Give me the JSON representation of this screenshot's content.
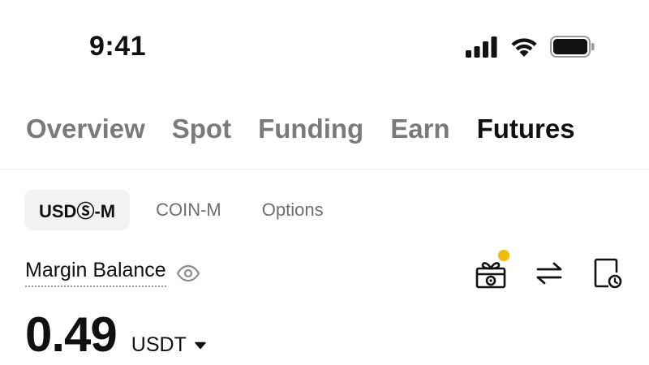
{
  "status_bar": {
    "time": "9:41"
  },
  "main_tabs": [
    {
      "label": "Overview",
      "active": false
    },
    {
      "label": "Spot",
      "active": false
    },
    {
      "label": "Funding",
      "active": false
    },
    {
      "label": "Earn",
      "active": false
    },
    {
      "label": "Futures",
      "active": true
    }
  ],
  "sub_tabs": [
    {
      "label": "USDⓈ-M",
      "active": true
    },
    {
      "label": "COIN-M",
      "active": false
    },
    {
      "label": "Options",
      "active": false
    }
  ],
  "balance": {
    "label": "Margin Balance",
    "amount": "0.49",
    "unit": "USDT"
  },
  "actions": {
    "gift_icon": "gift-icon",
    "transfer_icon": "transfer-icon",
    "history_icon": "history-icon"
  },
  "colors": {
    "accent_dot": "#f0b90b",
    "text_primary": "#111111",
    "text_muted": "#7a7a7a"
  }
}
